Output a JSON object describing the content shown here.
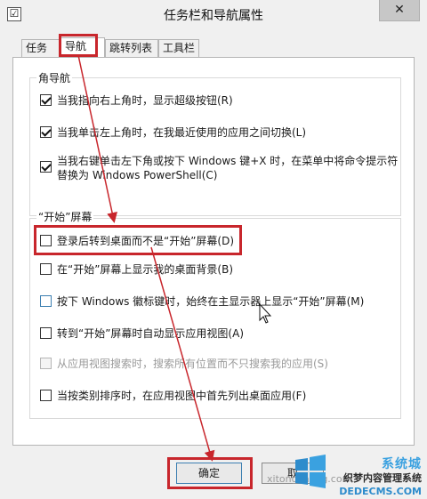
{
  "window": {
    "title": "任务栏和导航属性",
    "close_glyph": "✕",
    "app_icon_glyph": "☑"
  },
  "tabs": [
    {
      "label": "任务栏",
      "active": false
    },
    {
      "label": "导航",
      "active": true
    },
    {
      "label": "跳转列表",
      "active": false
    },
    {
      "label": "工具栏",
      "active": false
    }
  ],
  "corner_nav": {
    "legend": "角导航",
    "options": [
      {
        "label": "当我指向右上角时，显示超级按钮(R)",
        "checked": true
      },
      {
        "label": "当我单击左上角时，在我最近使用的应用之间切换(L)",
        "checked": true
      },
      {
        "label_line1": "当我右键单击左下角或按下 Windows 键+X 时，在菜单中将命令提示符",
        "label_line2": "替换为 Windows PowerShell(C)",
        "checked": true
      }
    ]
  },
  "start_screen": {
    "legend": "“开始”屏幕",
    "options": [
      {
        "label": "登录后转到桌面而不是“开始”屏幕(D)",
        "checked": false
      },
      {
        "label": "在“开始”屏幕上显示我的桌面背景(B)",
        "checked": false
      },
      {
        "label": "按下 Windows 徽标键时，始终在主显示器上显示“开始”屏幕(M)",
        "checked": false
      },
      {
        "label": "转到“开始”屏幕时自动显示应用视图(A)",
        "checked": false
      },
      {
        "label": "从应用视图搜索时，搜索所有位置而不只搜索我的应用(S)",
        "checked": false,
        "disabled": true
      },
      {
        "label": "当按类别排序时，在应用视图中首先列出桌面应用(F)",
        "checked": false
      }
    ]
  },
  "buttons": {
    "ok": "确定",
    "cancel": "取"
  },
  "watermark": {
    "line1": "系统城",
    "line2": "织梦内容管理系统",
    "line3": "DEDECMS.COM",
    "side": "xitongcheng.com"
  },
  "colors": {
    "highlight": "#c8262c",
    "focus_blue": "#3c7fb1"
  }
}
